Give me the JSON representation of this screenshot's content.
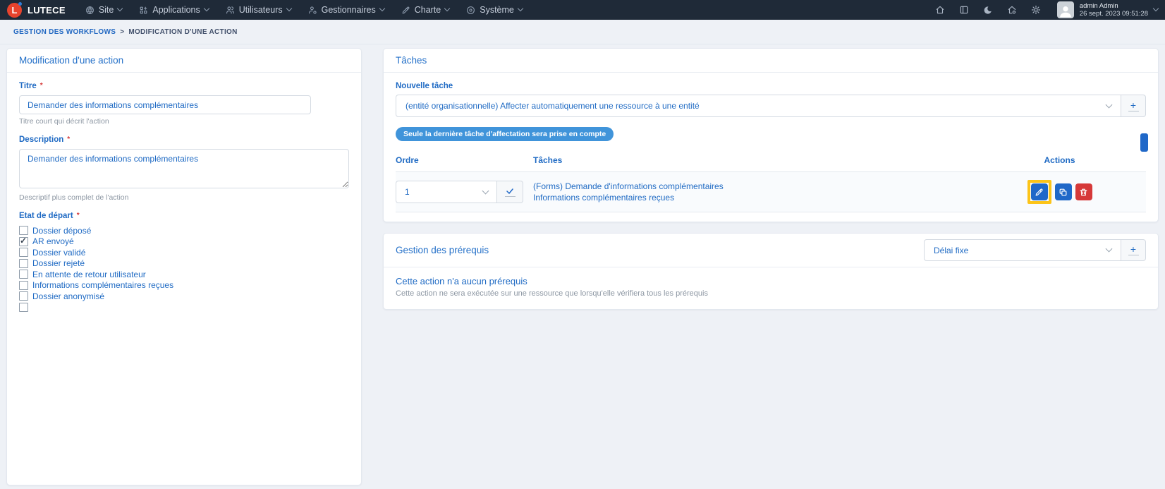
{
  "colors": {
    "primary": "#206bc4",
    "danger": "#d63939",
    "badge_blue": "#4094da",
    "highlight_yellow": "#fcc419",
    "navbar_bg": "#1f2a38",
    "logo_red": "#e8432d"
  },
  "navbar": {
    "brand": "LUTECE",
    "logo_letter": "L",
    "menus": [
      {
        "label": "Site",
        "icon": "globe"
      },
      {
        "label": "Applications",
        "icon": "apps-grid"
      },
      {
        "label": "Utilisateurs",
        "icon": "users"
      },
      {
        "label": "Gestionnaires",
        "icon": "user-cog"
      },
      {
        "label": "Charte",
        "icon": "pen"
      },
      {
        "label": "Système",
        "icon": "circle-dot"
      }
    ],
    "right_icons": [
      "home",
      "sidebar-panel",
      "dark-mode-moon",
      "site-home-cog",
      "settings-gear"
    ],
    "user": {
      "name": "admin Admin",
      "datetime": "26 sept. 2023 09:51:28"
    }
  },
  "breadcrumb": {
    "parent": "GESTION DES WORKFLOWS",
    "separator": ">",
    "current": "MODIFICATION D'UNE ACTION"
  },
  "action_card": {
    "title": "Modification d'une action",
    "titre": {
      "label": "Titre",
      "required": "*",
      "value": "Demander des informations complémentaires",
      "help": "Titre court qui décrit l'action"
    },
    "description": {
      "label": "Description",
      "required": "*",
      "value": "Demander des informations complémentaires",
      "help": "Descriptif plus complet de l'action"
    },
    "etat": {
      "label": "Etat de départ",
      "required": "*",
      "options": [
        {
          "label": "Dossier déposé",
          "checked": false
        },
        {
          "label": "AR envoyé",
          "checked": true
        },
        {
          "label": "Dossier validé",
          "checked": false
        },
        {
          "label": "Dossier rejeté",
          "checked": false
        },
        {
          "label": "En attente de retour utilisateur",
          "checked": false
        },
        {
          "label": "Informations complémentaires reçues",
          "checked": false
        },
        {
          "label": "Dossier anonymisé",
          "checked": false
        },
        {
          "label": "",
          "checked": false
        }
      ]
    }
  },
  "tasks_card": {
    "title": "Tâches",
    "new_task": {
      "label": "Nouvelle tâche",
      "value": "(entité organisationnelle) Affecter automatiquement une ressource à une entité",
      "add_label": "+"
    },
    "notice": "Seule la dernière tâche d'affectation sera prise en compte",
    "table": {
      "headers": {
        "order": "Ordre",
        "tasks": "Tâches",
        "actions": "Actions"
      },
      "rows": [
        {
          "order": "1",
          "task_line1": "(Forms) Demande d'informations complémentaires",
          "task_line2": "Informations complémentaires reçues"
        }
      ]
    }
  },
  "prereq_card": {
    "title": "Gestion des prérequis",
    "type_select_value": "Délai fixe",
    "add_label": "+",
    "empty_title": "Cette action n'a aucun prérequis",
    "empty_help": "Cette action ne sera exécutée sur une ressource que lorsqu'elle vérifiera tous les prérequis"
  }
}
